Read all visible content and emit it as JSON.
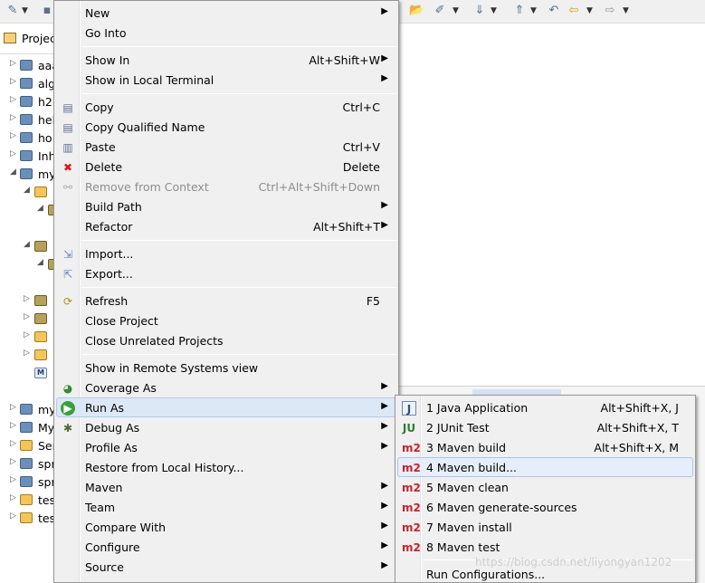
{
  "explorer": {
    "tab_label": "Project Explorer",
    "tree": [
      "aaa",
      "alg",
      "h2",
      "hel",
      "ho",
      "Inh",
      "my",
      "",
      "",
      "",
      "",
      "",
      "",
      "",
      "",
      "",
      "",
      "my",
      "My",
      "Ser",
      "spr",
      "spr",
      "tes",
      "tes"
    ]
  },
  "context_menu": {
    "items": [
      {
        "label": "New",
        "shortcut": "",
        "submenu": true
      },
      {
        "label": "Go Into",
        "shortcut": "",
        "submenu": false
      },
      {
        "label": "Show In",
        "shortcut": "Alt+Shift+W",
        "submenu": true
      },
      {
        "label": "Show in Local Terminal",
        "shortcut": "",
        "submenu": true
      },
      {
        "label": "Copy",
        "shortcut": "Ctrl+C",
        "submenu": false
      },
      {
        "label": "Copy Qualified Name",
        "shortcut": "",
        "submenu": false
      },
      {
        "label": "Paste",
        "shortcut": "Ctrl+V",
        "submenu": false
      },
      {
        "label": "Delete",
        "shortcut": "Delete",
        "submenu": false
      },
      {
        "label": "Remove from Context",
        "shortcut": "Ctrl+Alt+Shift+Down",
        "submenu": false,
        "disabled": true
      },
      {
        "label": "Build Path",
        "shortcut": "",
        "submenu": true
      },
      {
        "label": "Refactor",
        "shortcut": "Alt+Shift+T",
        "submenu": true
      },
      {
        "label": "Import...",
        "shortcut": "",
        "submenu": false
      },
      {
        "label": "Export...",
        "shortcut": "",
        "submenu": false
      },
      {
        "label": "Refresh",
        "shortcut": "F5",
        "submenu": false
      },
      {
        "label": "Close Project",
        "shortcut": "",
        "submenu": false
      },
      {
        "label": "Close Unrelated Projects",
        "shortcut": "",
        "submenu": false
      },
      {
        "label": "Show in Remote Systems view",
        "shortcut": "",
        "submenu": false
      },
      {
        "label": "Coverage As",
        "shortcut": "",
        "submenu": true
      },
      {
        "label": "Run As",
        "shortcut": "",
        "submenu": true
      },
      {
        "label": "Debug As",
        "shortcut": "",
        "submenu": true
      },
      {
        "label": "Profile As",
        "shortcut": "",
        "submenu": true
      },
      {
        "label": "Restore from Local History...",
        "shortcut": "",
        "submenu": false
      },
      {
        "label": "Maven",
        "shortcut": "",
        "submenu": true
      },
      {
        "label": "Team",
        "shortcut": "",
        "submenu": true
      },
      {
        "label": "Compare With",
        "shortcut": "",
        "submenu": true
      },
      {
        "label": "Configure",
        "shortcut": "",
        "submenu": true
      },
      {
        "label": "Source",
        "shortcut": "",
        "submenu": true
      }
    ]
  },
  "run_as_menu": {
    "items": [
      {
        "label": "1 Java Application",
        "shortcut": "Alt+Shift+X, J",
        "icon": "J"
      },
      {
        "label": "2 JUnit Test",
        "shortcut": "Alt+Shift+X, T",
        "icon": "JU"
      },
      {
        "label": "3 Maven build",
        "shortcut": "Alt+Shift+X, M",
        "icon": "m2"
      },
      {
        "label": "4 Maven build...",
        "shortcut": "",
        "icon": "m2"
      },
      {
        "label": "5 Maven clean",
        "shortcut": "",
        "icon": "m2"
      },
      {
        "label": "6 Maven generate-sources",
        "shortcut": "",
        "icon": "m2"
      },
      {
        "label": "7 Maven install",
        "shortcut": "",
        "icon": "m2"
      },
      {
        "label": "8 Maven test",
        "shortcut": "",
        "icon": "m2"
      },
      {
        "label": "Run Configurations...",
        "shortcut": "",
        "icon": ""
      }
    ]
  },
  "watermark": "https://blog.csdn.net/liyongyan1202",
  "colors": {
    "menu_bg": "#f0f0f0",
    "hover_bg": "#dde8f6",
    "hover_border": "#aecbf0",
    "disabled_text": "#8d8d8d",
    "maven_red": "#c8232c"
  }
}
